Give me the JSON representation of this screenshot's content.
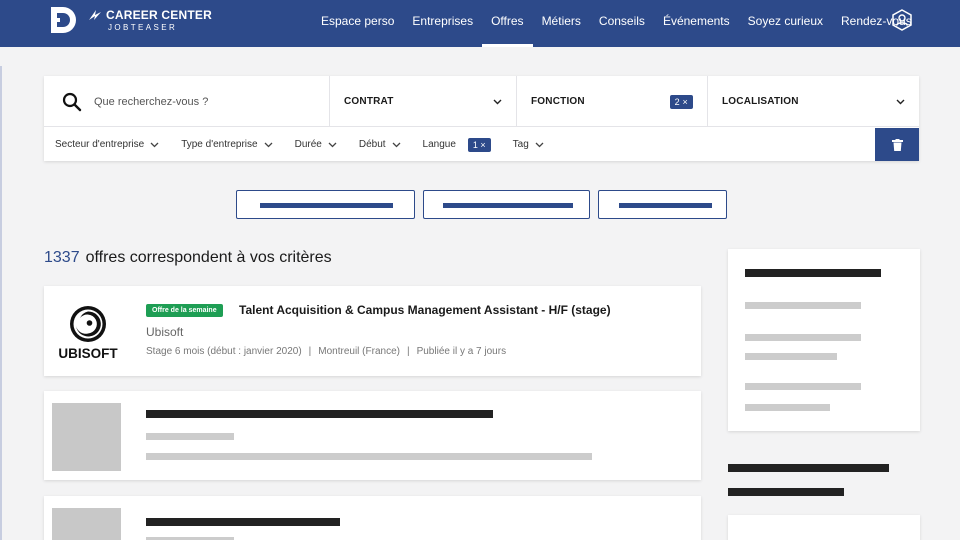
{
  "header": {
    "logo_line1": "CAREER CENTER",
    "logo_line2": "JOBTEASER",
    "nav": [
      {
        "label": "Espace perso"
      },
      {
        "label": "Entreprises"
      },
      {
        "label": "Offres",
        "active": true
      },
      {
        "label": "Métiers"
      },
      {
        "label": "Conseils"
      },
      {
        "label": "Événements"
      },
      {
        "label": "Soyez curieux"
      },
      {
        "label": "Rendez-vous"
      }
    ],
    "profile_icon": "user-shield-icon",
    "brand_color": "#2d4a8a"
  },
  "search": {
    "placeholder": "Que recherchez-vous ?",
    "contrat_label": "CONTRAT",
    "fonction_label": "FONCTION",
    "fonction_badge": "2 ×",
    "localisation_label": "LOCALISATION"
  },
  "filters": {
    "secteur": "Secteur d'entreprise",
    "type": "Type d'entreprise",
    "duree": "Durée",
    "debut": "Début",
    "langue": "Langue",
    "langue_badge": "1 ×",
    "tag": "Tag",
    "clear_icon": "trash-icon"
  },
  "results": {
    "count": "1337",
    "label": "offres correspondent à vos critères"
  },
  "offer": {
    "badge": "Offre de la semaine",
    "badge_color": "#1e9e54",
    "title": "Talent Acquisition & Campus Management Assistant - H/F (stage)",
    "company": "Ubisoft",
    "logo_text": "UBISOFT",
    "contract": "Stage 6 mois (début : janvier 2020)",
    "separator": "|",
    "location": "Montreuil (France)",
    "published": "Publiée il y a 7 jours"
  }
}
